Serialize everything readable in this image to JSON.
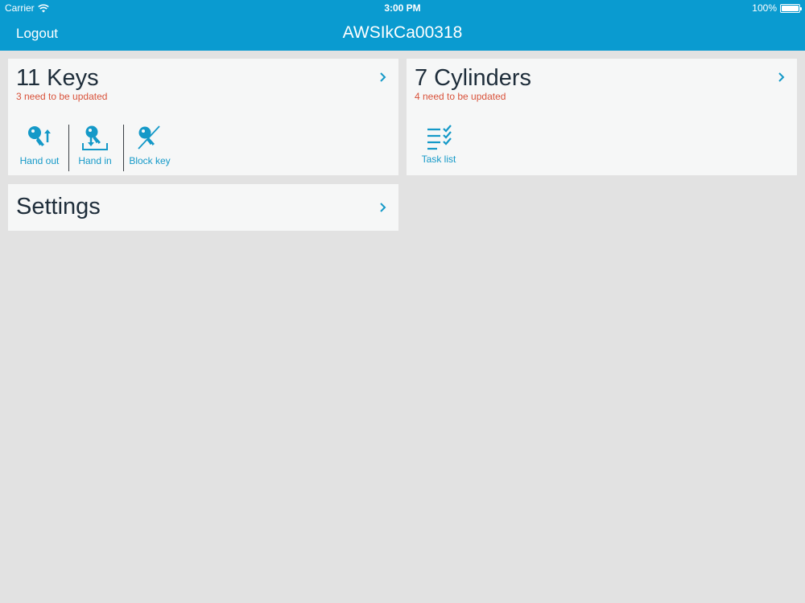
{
  "status_bar": {
    "carrier": "Carrier",
    "time": "3:00 PM",
    "battery": "100%"
  },
  "nav": {
    "left_button": "Logout",
    "title": "AWSIkCa00318"
  },
  "keys_card": {
    "title": "11 Keys",
    "subtitle": "3 need to be updated",
    "actions": [
      {
        "label": "Hand out",
        "icon": "key-hand-out-icon"
      },
      {
        "label": "Hand in",
        "icon": "key-hand-in-icon"
      },
      {
        "label": "Block key",
        "icon": "key-block-icon"
      }
    ]
  },
  "cylinders_card": {
    "title": "7 Cylinders",
    "subtitle": "4 need to be updated",
    "actions": [
      {
        "label": "Task list",
        "icon": "task-list-icon"
      }
    ]
  },
  "settings_card": {
    "title": "Settings"
  },
  "colors": {
    "accent": "#0a9bd0",
    "icon": "#1499c8",
    "warning": "#d9533b",
    "background": "#e2e2e2",
    "card": "#f6f7f7"
  }
}
